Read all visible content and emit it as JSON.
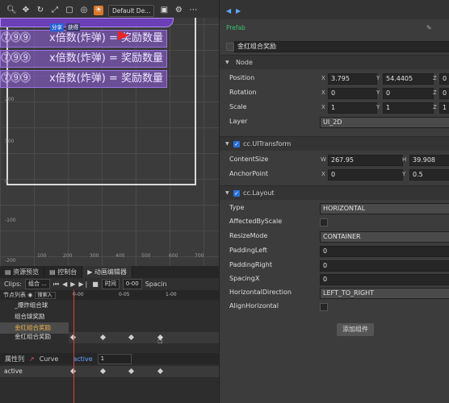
{
  "scene": {
    "zoom_icon": "zoom-icon",
    "camera_dropdown": "Default De...",
    "rows": [
      {
        "coins": "⓻⓽⓽",
        "formula": "x倍数(炸弹) = 奖励数量"
      },
      {
        "coins": "⓻⓽⓽",
        "formula": "x倍数(炸弹) = 奖励数量"
      },
      {
        "coins": "⓻⓽⓽",
        "formula": "x倍数(炸弹) = 奖励数量"
      }
    ],
    "tag_left": "分享",
    "tag_right": "获得",
    "y_labels": [
      "200",
      "100",
      "0",
      "-100",
      "-200"
    ],
    "x_labels": [
      "100",
      "200",
      "300",
      "400",
      "500",
      "600",
      "700"
    ],
    "corner_labels": [
      "-200"
    ]
  },
  "bottom": {
    "tabs": [
      "资源预览",
      "控制台",
      "动画编辑器"
    ],
    "clips_label": "Clips:",
    "clips_value": "组合 ...",
    "time_label": "时间",
    "time_value": "0-00",
    "spacing_label": "Spacin",
    "node_list_label": "节点列表",
    "filter_placeholder": "搜索入",
    "ruler": [
      "0-00",
      "0-05",
      "1-00"
    ],
    "nodes": [
      "_爆炸组合球",
      "组合球奖励",
      "金红组合奖励",
      "金红组合奖励"
    ],
    "prop_tab": "属性列",
    "curve_tab": "Curve",
    "prop_input_label": "active",
    "prop_input_value": "1",
    "prop_name": "active"
  },
  "inspector": {
    "prefab": "Prefab",
    "node_name": "金红组合奖励",
    "section_node": "Node",
    "position_label": "Position",
    "position": {
      "x": "3.795",
      "y": "54.4405",
      "z": "0"
    },
    "rotation_label": "Rotation",
    "rotation": {
      "x": "0",
      "y": "0",
      "z": "0"
    },
    "scale_label": "Scale",
    "scale": {
      "x": "1",
      "y": "1",
      "z": "1"
    },
    "layer_label": "Layer",
    "layer": "UI_2D",
    "section_uitransform": "cc.UITransform",
    "contentsize_label": "ContentSize",
    "contentsize": {
      "w": "267.95",
      "h": "39.908"
    },
    "anchor_label": "AnchorPoint",
    "anchor": {
      "x": "0",
      "y": "0.5"
    },
    "section_layout": "cc.Layout",
    "type_label": "Type",
    "type": "HORIZONTAL",
    "affected_label": "AffectedByScale",
    "resize_label": "ResizeMode",
    "resize": "CONTAINER",
    "padleft_label": "PaddingLeft",
    "padleft": "0",
    "padright_label": "PaddingRight",
    "padright": "0",
    "spacingx_label": "SpacingX",
    "spacingx": "0",
    "hdir_label": "HorizontalDirection",
    "hdir": "LEFT_TO_RIGHT",
    "alignh_label": "AlignHorizontal",
    "add_component": "添加组件",
    "axis_x": "X",
    "axis_y": "Y",
    "axis_z": "Z",
    "axis_w": "W",
    "axis_h": "H"
  }
}
